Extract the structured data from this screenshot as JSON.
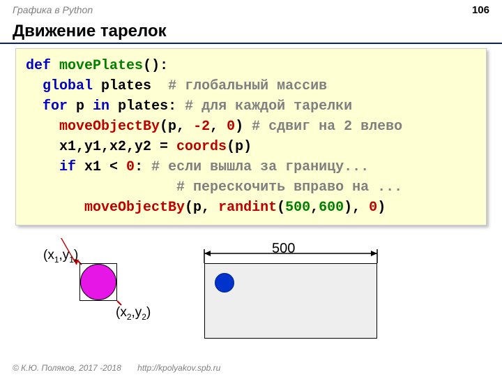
{
  "header": {
    "course": "Графика в Python",
    "page": "106"
  },
  "title": "Движение тарелок",
  "code": {
    "l1": {
      "def": "def",
      "fn": "movePlates",
      "paren": "():"
    },
    "l2": {
      "indent": "  ",
      "global": "global",
      "var": " plates  ",
      "comment": "# глобальный массив"
    },
    "l3": {
      "indent": "  ",
      "for": "for",
      "p": " p ",
      "in": "in",
      "plates": " plates: ",
      "comment": "# для каждой тарелки"
    },
    "l4": {
      "indent": "    ",
      "fn": "moveObjectBy",
      "open": "(p, ",
      "n1": "-2",
      "mid": ", ",
      "n2": "0",
      "close": ") ",
      "comment": "# сдвиг на 2 влево"
    },
    "l5": {
      "indent": "    ",
      "lhs": "x1,y1,x2,y2 = ",
      "fn": "coords",
      "args": "(p)"
    },
    "l6": {
      "indent": "    ",
      "if": "if",
      "cond": " x1 < ",
      "zero": "0",
      "colon": ": ",
      "comment": "# если вышла за границу..."
    },
    "l7": {
      "indent": "                  ",
      "comment": "# перескочить вправо на ..."
    },
    "l8": {
      "indent": "       ",
      "fn": "moveObjectBy",
      "open": "(p, ",
      "rfn": "randint",
      "ropen": "(",
      "n1": "500",
      "comma": ",",
      "n2": "600",
      "rclose": ")",
      "mid": ", ",
      "n3": "0",
      "close": ")"
    }
  },
  "diagram": {
    "topLabel": "(x",
    "topSub": "1",
    "topLabel2": ",y",
    "topSub2": "1",
    "topClose": ")",
    "botLabel": "(x",
    "botSub": "2",
    "botLabel2": ",y",
    "botSub2": "2",
    "botClose": ")",
    "dim": "500"
  },
  "footer": {
    "copyright": "© К.Ю. Поляков, 2017 -2018",
    "url": "http://kpolyakov.spb.ru"
  }
}
